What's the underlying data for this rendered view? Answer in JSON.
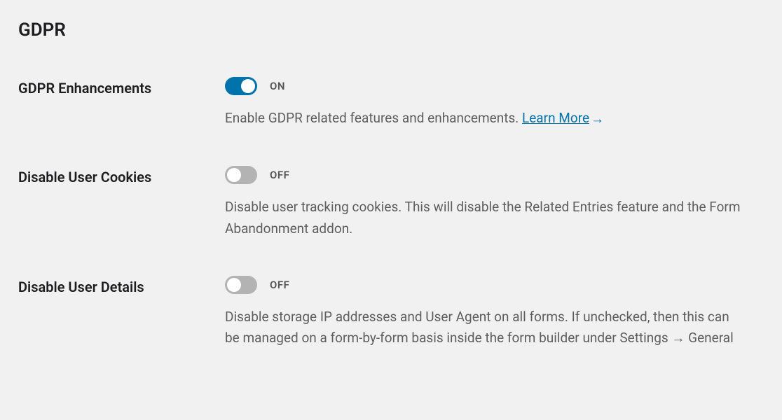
{
  "section": {
    "title": "GDPR"
  },
  "settings": {
    "enhancements": {
      "label": "GDPR Enhancements",
      "state": "ON",
      "enabled": true,
      "description": "Enable GDPR related features and enhancements. ",
      "learnMore": "Learn More"
    },
    "cookies": {
      "label": "Disable User Cookies",
      "state": "OFF",
      "enabled": false,
      "description": "Disable user tracking cookies. This will disable the Related Entries feature and the Form Abandonment addon."
    },
    "details": {
      "label": "Disable User Details",
      "state": "OFF",
      "enabled": false,
      "description": "Disable storage IP addresses and User Agent on all forms. If unchecked, then this can be managed on a form-by-form basis inside the form builder under Settings → General"
    }
  }
}
